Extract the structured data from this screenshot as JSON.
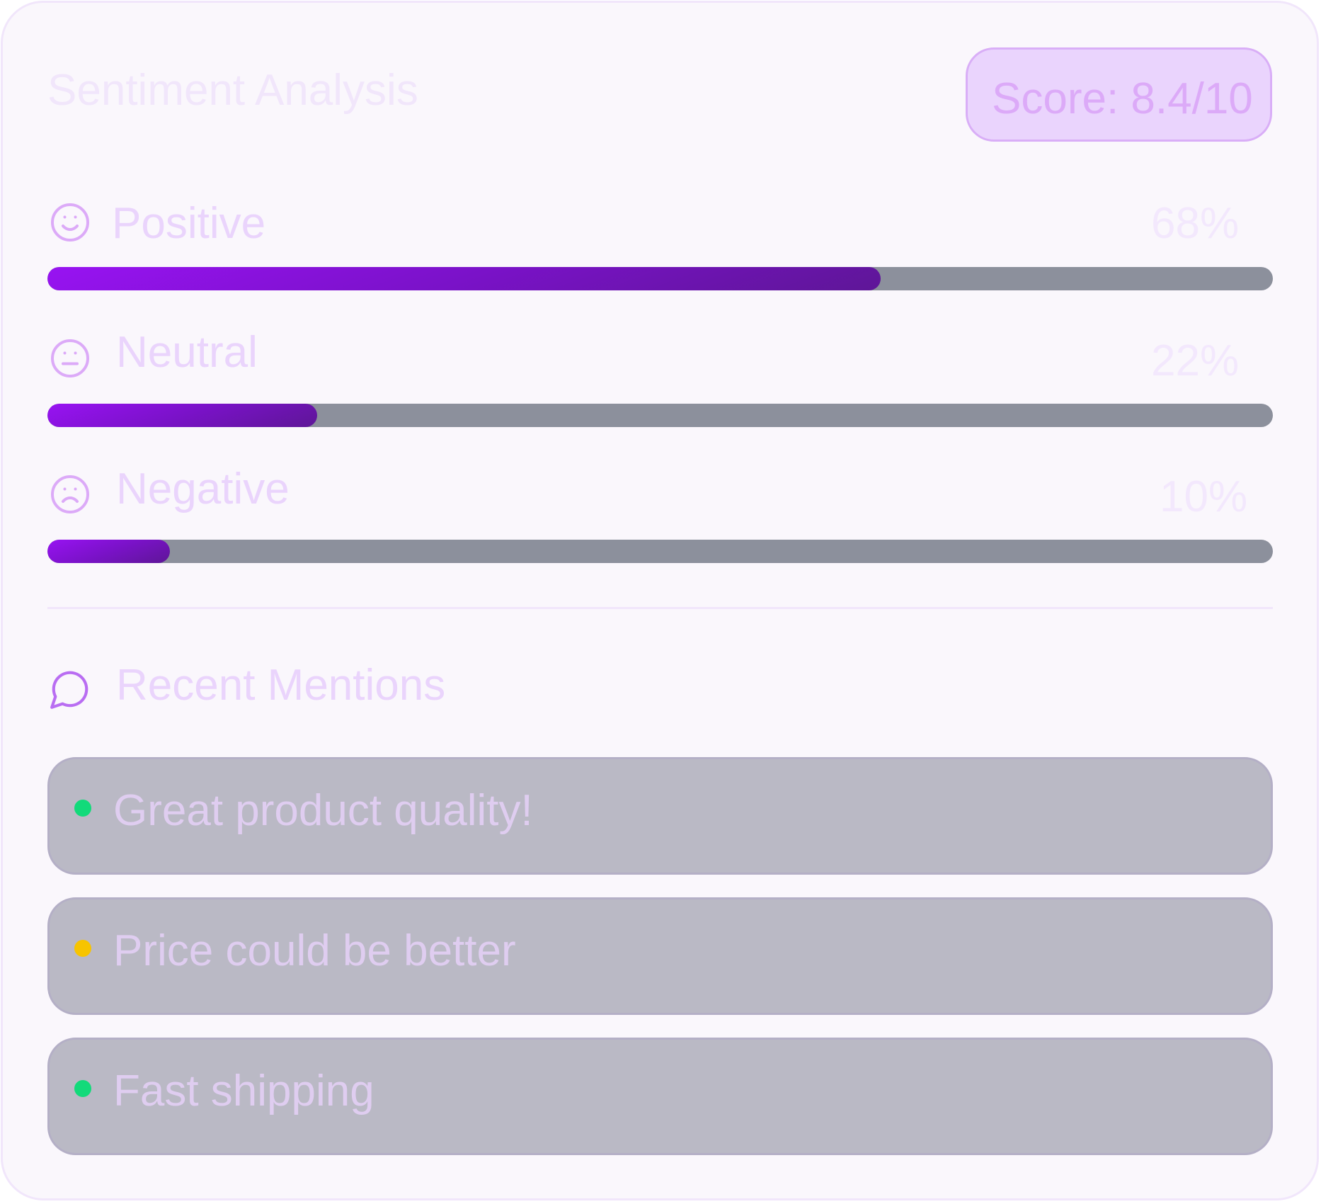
{
  "card": {
    "title": "Sentiment Analysis",
    "score_label": "Score: 8.4/10"
  },
  "sentiment": [
    {
      "label": "Positive",
      "percent_text": "68%",
      "value": 0.68,
      "icon": "smile-icon"
    },
    {
      "label": "Neutral",
      "percent_text": "22%",
      "value": 0.22,
      "icon": "neutral-face-icon"
    },
    {
      "label": "Negative",
      "percent_text": "10%",
      "value": 0.1,
      "icon": "frown-icon"
    }
  ],
  "mentions": {
    "title": "Recent Mentions",
    "icon": "message-circle-icon",
    "items": [
      {
        "text": "Great product quality!",
        "status_color": "#12da7a"
      },
      {
        "text": "Price could be better",
        "status_color": "#f7c400"
      },
      {
        "text": "Fast shipping",
        "status_color": "#12da7a"
      }
    ]
  },
  "colors": {
    "accent": "#9813f2",
    "track": "#8c909c",
    "badge_background": "#ead4fd"
  }
}
